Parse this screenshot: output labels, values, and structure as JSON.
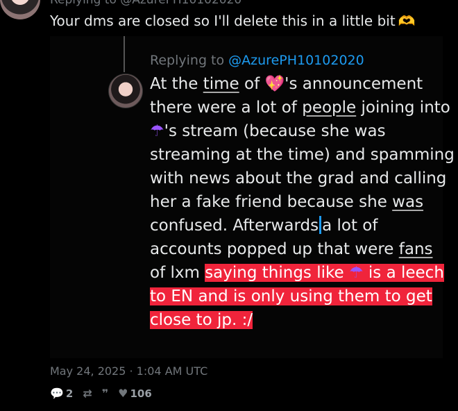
{
  "top": {
    "replying_prefix": "Replying to ",
    "replying_handle": "@AzurePH10102020"
  },
  "tweet": {
    "text": "Your dms are closed so I'll delete this in a little bit",
    "emoji": "🫶"
  },
  "quoted": {
    "replying_prefix": "Replying to ",
    "replying_handle": "@AzurePH10102020",
    "lines": [
      "At the time of 💖's announcement",
      "there were a lot of people joining into",
      "☂️'s stream (because she was",
      "streaming at the time) and spamming",
      "with news about the grad and calling",
      "her a fake friend because she was",
      "confused. Afterwards a lot of",
      "accounts popped up that were fans",
      "of lxm saying things like ☂️ is a leech",
      "to EN and is only using them to get",
      "close to jp. :/"
    ]
  },
  "meta": {
    "date": "May 24, 2025 · 1:04 AM UTC"
  },
  "actions": {
    "reply_count": "2",
    "like_count": "106"
  },
  "colors": {
    "highlight": "#f0243b",
    "link": "#1d9bf0",
    "muted": "#71767b"
  }
}
